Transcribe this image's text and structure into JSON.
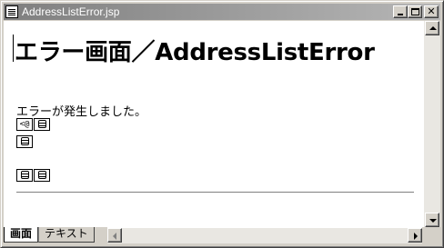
{
  "window": {
    "title": "AddressListError.jsp",
    "icon": "document-icon",
    "controls": {
      "minimize": "minimize-icon",
      "maximize": "maximize-icon",
      "close": "close-icon"
    }
  },
  "page": {
    "heading": "エラー画面／AddressListError",
    "message": "エラーが発生しました。"
  },
  "tags": [
    {
      "label": "<@",
      "icon": "jsp-tag-icon"
    },
    {
      "label": "",
      "icon": "scroll-icon"
    },
    {
      "label": "",
      "icon": "scroll-icon"
    },
    {
      "label": "",
      "icon": "scroll-icon"
    },
    {
      "label": "",
      "icon": "scroll-icon"
    }
  ],
  "tabs": [
    {
      "label": "画面",
      "active": true
    },
    {
      "label": "テキスト",
      "active": false
    }
  ],
  "colors": {
    "titlebar_gradient_start": "#7f7f7f",
    "titlebar_gradient_end": "#b6b6b6",
    "window_face": "#d4d0c8",
    "content_background": "#ffffff"
  }
}
